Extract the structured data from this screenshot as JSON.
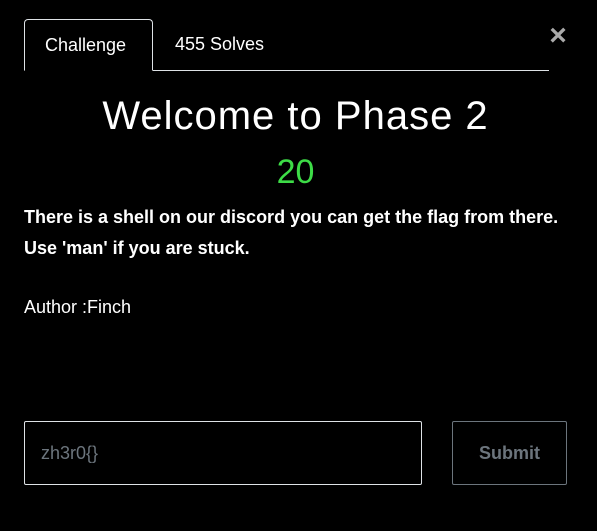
{
  "tabs": [
    {
      "label": "Challenge",
      "active": true
    },
    {
      "label": "455 Solves",
      "active": false
    }
  ],
  "close_glyph": "×",
  "challenge": {
    "title": "Welcome to Phase 2",
    "points": "20",
    "description_lines": [
      "There is a shell on our discord you can get the flag from there.",
      "Use 'man' if you are stuck."
    ],
    "author": "Author :Finch"
  },
  "form": {
    "flag_placeholder": "zh3r0{}",
    "flag_value": "",
    "submit_label": "Submit"
  },
  "colors": {
    "background": "#000000",
    "text": "#ffffff",
    "points": "#3ddc47",
    "border": "#dee2e6",
    "muted": "#6c757d"
  }
}
